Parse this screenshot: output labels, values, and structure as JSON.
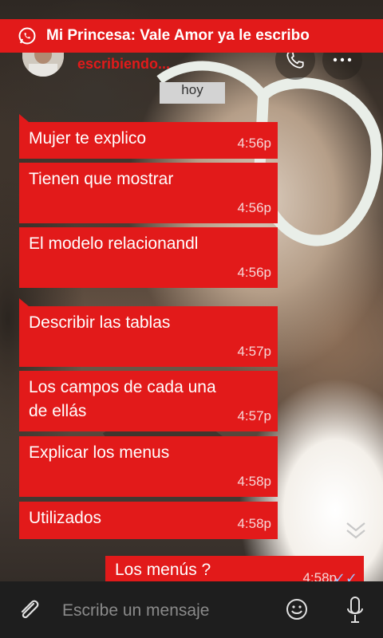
{
  "status_bar": {
    "notification": "Mi Princesa: Vale Amor ya le escribo"
  },
  "header": {
    "contact_status": "escribiendo..."
  },
  "date_separator": "hoy",
  "messages_in": [
    {
      "text": "Mujer te explico",
      "time": "4:56p"
    },
    {
      "text": "Tienen que mostrar",
      "time": "4:56p"
    },
    {
      "text": "El modelo relacionandl",
      "time": "4:56p"
    },
    {
      "text": "Describir las tablas",
      "time": "4:57p"
    },
    {
      "text": "Los campos de cada una de ellás",
      "time": "4:57p"
    },
    {
      "text": "Explicar los menus",
      "time": "4:58p"
    },
    {
      "text": "Utilizados",
      "time": "4:58p"
    }
  ],
  "message_out": {
    "text": "Los menús ?",
    "time": "4:58p",
    "check": "✓✓"
  },
  "composer": {
    "placeholder": "Escribe un mensaje"
  },
  "colors": {
    "accent": "#e21a1a",
    "composer_bg": "#1e1e1e"
  },
  "icons": [
    "whatsapp-icon",
    "phone-icon",
    "more-options-icon",
    "chevron-double-down-icon",
    "attach-icon",
    "emoji-icon",
    "microphone-icon"
  ]
}
